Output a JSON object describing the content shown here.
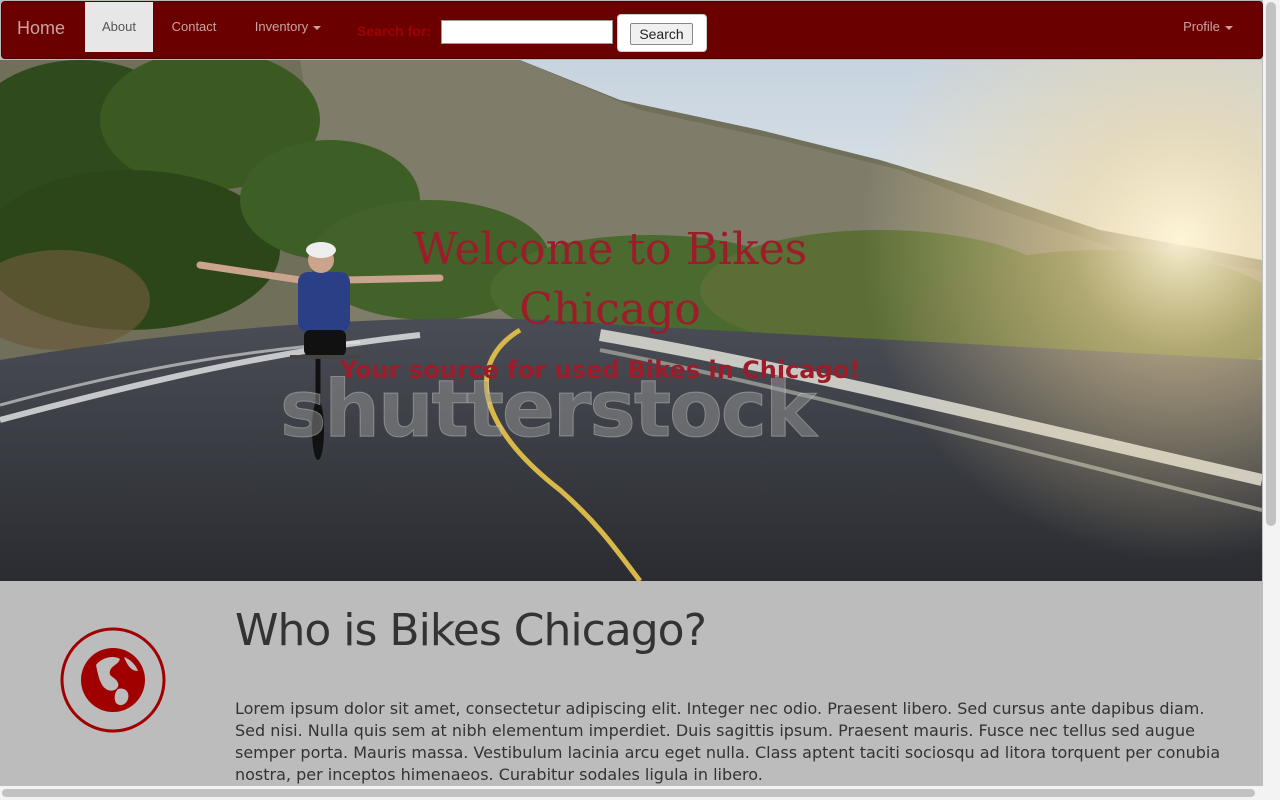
{
  "navbar": {
    "brand": "Home",
    "items": [
      {
        "label": "About",
        "active": true
      },
      {
        "label": "Contact"
      },
      {
        "label": "Inventory",
        "dropdown": true
      }
    ],
    "search": {
      "label": "Search for:",
      "value": "",
      "button_label": "Search"
    },
    "profile": {
      "label": "Profile",
      "dropdown": true
    }
  },
  "hero": {
    "title": "Welcome to Bikes Chicago",
    "subtitle": "Your source for used Bikes in Chicago!",
    "watermark": "shutterstock"
  },
  "about": {
    "icon": "globe-icon",
    "heading": "Who is Bikes Chicago?",
    "body": "Lorem ipsum dolor sit amet, consectetur adipiscing elit. Integer nec odio. Praesent libero. Sed cursus ante dapibus diam. Sed nisi. Nulla quis sem at nibh elementum imperdiet. Duis sagittis ipsum. Praesent mauris. Fusce nec tellus sed augue semper porta. Mauris massa. Vestibulum lacinia arcu eget nulla. Class aptent taciti sociosqu ad litora torquent per conubia nostra, per inceptos himenaeos. Curabitur sodales ligula in libero."
  },
  "colors": {
    "navbar_bg": "#6b0000",
    "accent": "#a00000",
    "hero_text": "#9c1c2a",
    "section_bg": "#bcbcbc"
  }
}
